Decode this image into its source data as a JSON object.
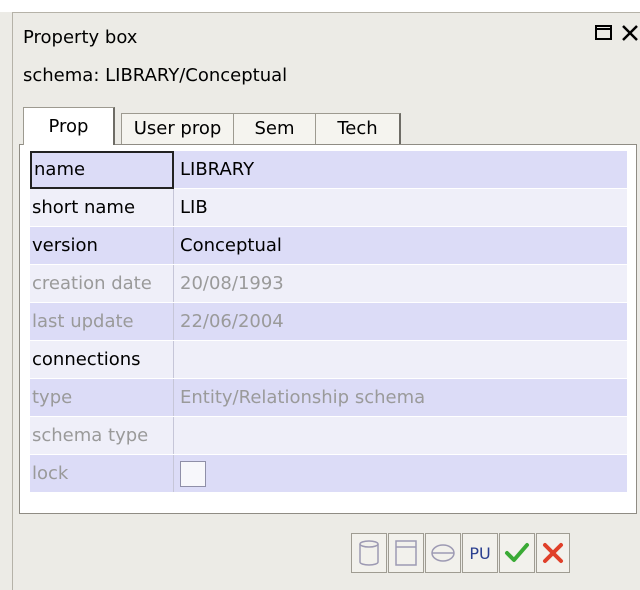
{
  "window": {
    "title": "Property box",
    "restore_icon": "restore-window-icon",
    "close_icon": "close-icon"
  },
  "schema_label": "schema: LIBRARY/Conceptual",
  "tabs": [
    {
      "label": "Prop",
      "active": true
    },
    {
      "label": "User prop",
      "active": false
    },
    {
      "label": "Sem",
      "active": false
    },
    {
      "label": "Tech",
      "active": false
    }
  ],
  "properties": [
    {
      "name": "name",
      "value": "LIBRARY",
      "enabled": true
    },
    {
      "name": "short name",
      "value": "LIB",
      "enabled": true
    },
    {
      "name": "version",
      "value": "Conceptual",
      "enabled": true
    },
    {
      "name": "creation date",
      "value": "20/08/1993",
      "enabled": false
    },
    {
      "name": "last update",
      "value": "22/06/2004",
      "enabled": false
    },
    {
      "name": "connections",
      "value": "",
      "enabled": true
    },
    {
      "name": "type",
      "value": "Entity/Relationship schema",
      "enabled": false
    },
    {
      "name": "schema type",
      "value": "",
      "enabled": false
    },
    {
      "name": "lock",
      "value": "",
      "enabled": false,
      "checkbox": true
    }
  ],
  "toolbar": {
    "pu_label": "PU",
    "icons": [
      "cylinder-icon",
      "table-icon",
      "disk-icon",
      "pu-button",
      "check-icon",
      "cross-icon"
    ]
  },
  "colors": {
    "row_shaded": "#dcdcf7",
    "row_light": "#efeff9",
    "check_green": "#3aaa35",
    "cross_red": "#e0402a"
  }
}
